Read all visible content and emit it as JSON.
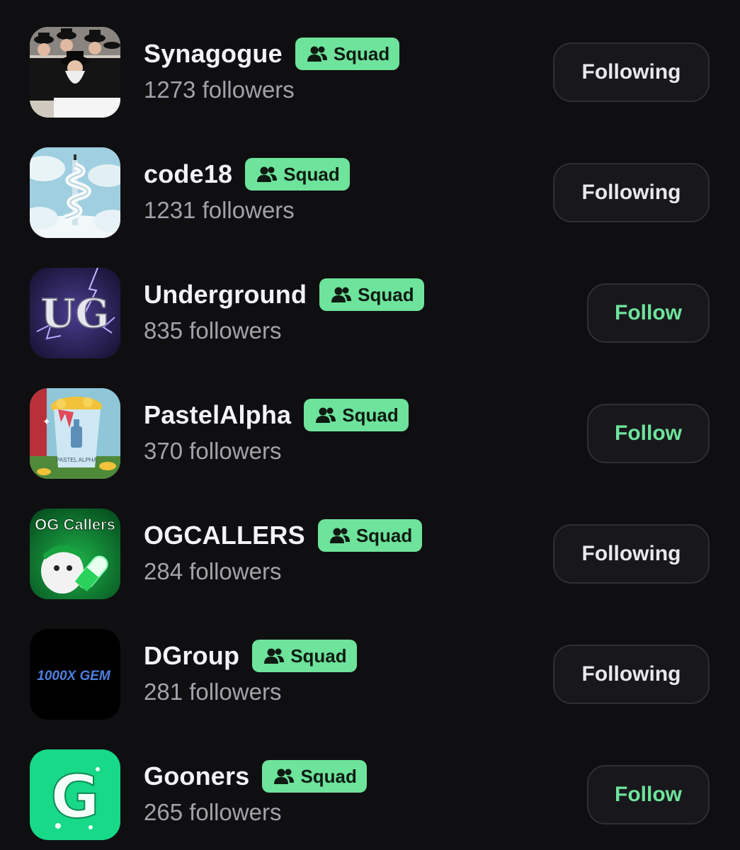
{
  "squads": [
    {
      "name": "Synagogue",
      "badge": "Squad",
      "followers": "1273 followers",
      "button": "Following",
      "state": "following",
      "avatar_icon": "group-photo-avatar"
    },
    {
      "name": "code18",
      "badge": "Squad",
      "followers": "1231 followers",
      "button": "Following",
      "state": "following",
      "avatar_icon": "spiral-staircase-clouds-avatar"
    },
    {
      "name": "Underground",
      "badge": "Squad",
      "followers": "835 followers",
      "button": "Follow",
      "state": "follow",
      "avatar_icon": "ug-lightning-avatar",
      "avatar_text": "UG"
    },
    {
      "name": "PastelAlpha",
      "badge": "Squad",
      "followers": "370 followers",
      "button": "Follow",
      "state": "follow",
      "avatar_icon": "pastel-alpha-bag-avatar",
      "avatar_text": "PASTEL ALPHA"
    },
    {
      "name": "OGCALLERS",
      "badge": "Squad",
      "followers": "284 followers",
      "button": "Following",
      "state": "following",
      "avatar_icon": "og-callers-pill-avatar",
      "avatar_text": "OG Callers"
    },
    {
      "name": "DGroup",
      "badge": "Squad",
      "followers": "281 followers",
      "button": "Following",
      "state": "following",
      "avatar_icon": "1000x-gem-avatar",
      "avatar_text": "1000X GEM"
    },
    {
      "name": "Gooners",
      "badge": "Squad",
      "followers": "265 followers",
      "button": "Follow",
      "state": "follow",
      "avatar_icon": "gooners-g-avatar",
      "avatar_text": "G"
    }
  ],
  "colors": {
    "background": "#0f0f12",
    "badge_green": "#6ee39b",
    "follow_text": "#6ee39b",
    "following_text": "#e8e8ec",
    "followers_text": "#a2a2aa"
  }
}
